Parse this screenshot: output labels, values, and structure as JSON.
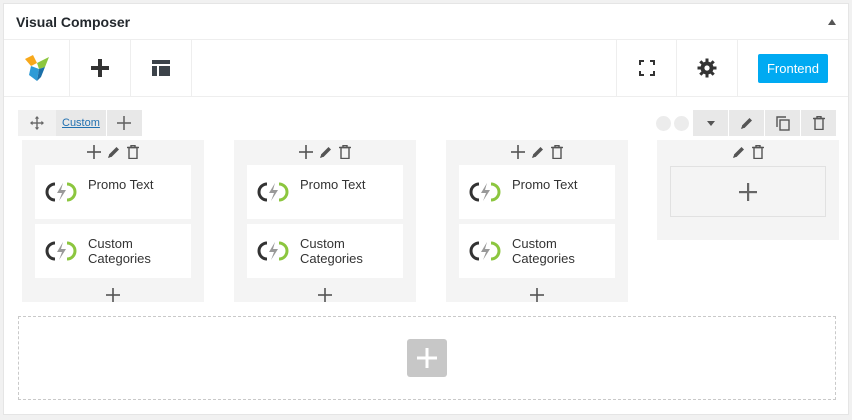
{
  "panel": {
    "title": "Visual Composer"
  },
  "toolbar": {
    "logo_icon": "vc-logo-icon",
    "add_icon": "plus-icon",
    "templates_icon": "templates-icon",
    "fullscreen_icon": "fullscreen-icon",
    "settings_icon": "gear-icon",
    "frontend_label": "Frontend",
    "frontend_color": "#00aaf2"
  },
  "row": {
    "layout_label": "Custom",
    "columns": [
      {
        "elements": [
          {
            "label": "Promo Text"
          },
          {
            "label": "Custom Categories"
          }
        ]
      },
      {
        "elements": [
          {
            "label": "Promo Text"
          },
          {
            "label": "Custom Categories"
          }
        ]
      },
      {
        "elements": [
          {
            "label": "Promo Text"
          },
          {
            "label": "Custom Categories"
          }
        ]
      },
      {
        "elements": []
      }
    ]
  },
  "colors": {
    "accent": "#00aaf2",
    "logo_green": "#8cc63f",
    "logo_orange": "#f7a81b"
  }
}
